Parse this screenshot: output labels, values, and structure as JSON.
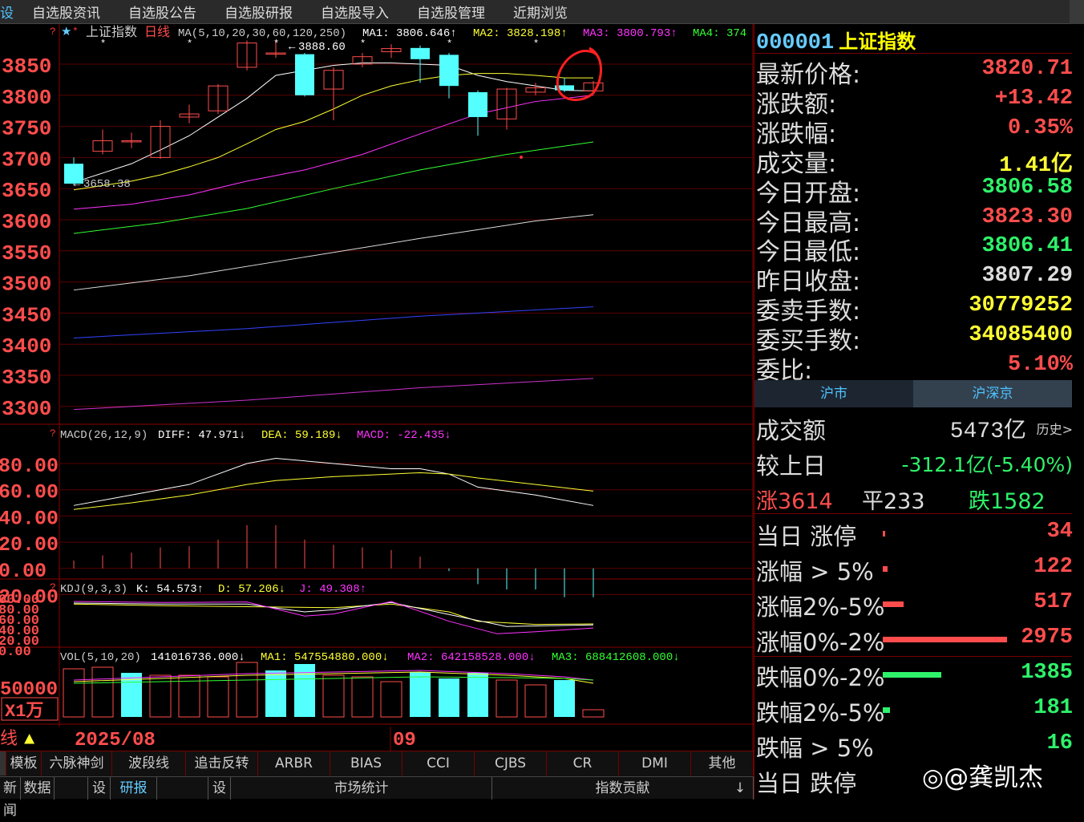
{
  "menu": [
    "设",
    "自选股资讯",
    "自选股公告",
    "自选股研报",
    "自选股导入",
    "自选股管理",
    "近期浏览"
  ],
  "chart": {
    "title": "上证指数",
    "period": "日线",
    "ma_params": "MA(5,10,20,30,60,120,250)",
    "ma1": "MA1: 3806.646↑",
    "ma2": "MA2: 3828.198↑",
    "ma3": "MA3: 3800.793↑",
    "ma4": "MA4: 374",
    "high_label": "3888.60",
    "low_label": "3658.38",
    "price_ticks": [
      "3850",
      "3800",
      "3750",
      "3700",
      "3650",
      "3600",
      "3550",
      "3500",
      "3450",
      "3400",
      "3350",
      "3300"
    ],
    "macd_title": "MACD(26,12,9)",
    "macd_diff": "DIFF: 47.971↓",
    "macd_dea": "DEA: 59.189↓",
    "macd_val": "MACD: -22.435↓",
    "macd_ticks": [
      "80.00",
      "60.00",
      "40.00",
      "20.00",
      "0.00",
      "20.00"
    ],
    "kdj_title": "KDJ(9,3,3)",
    "kdj_k": "K: 54.573↑",
    "kdj_d": "D: 57.206↓",
    "kdj_j": "J: 49.308↑",
    "kdj_ticks": [
      "00.00",
      "80.00",
      "60.00",
      "40.00",
      "20.00",
      "0.00"
    ],
    "vol_title": "VOL(5,10,20)",
    "vol_val": "141016736.000↓",
    "vol_ma1": "MA1: 547554880.000↓",
    "vol_ma2": "MA2: 642158528.000↓",
    "vol_ma3": "MA3: 688412608.000↓",
    "vol_tick": "50000",
    "vol_unit": "X1万",
    "line_label": "线",
    "date_left": "2025/08",
    "date_mid": "09"
  },
  "bottom_tabs": [
    "模板",
    "六脉神剑",
    "波段线",
    "追击反转",
    "ARBR",
    "BIAS",
    "CCI",
    "CJBS",
    "CR",
    "DMI",
    "其他"
  ],
  "bottom_tabs2": [
    "新闻",
    "数据",
    "设",
    "研报",
    "设",
    "市场统计",
    "指数贡献"
  ],
  "quote": {
    "code": "000001",
    "name": "上证指数",
    "rows": [
      {
        "label": "最新价格:",
        "value": "3820.71",
        "color": "#ff4d4d"
      },
      {
        "label": "涨跌额:",
        "value": "+13.42",
        "color": "#ff4d4d"
      },
      {
        "label": "涨跌幅:",
        "value": "0.35%",
        "color": "#ff4d4d"
      },
      {
        "label": "成交量:",
        "value": "1.41亿",
        "color": "#ffff33"
      },
      {
        "label": "今日开盘:",
        "value": "3806.58",
        "color": "#2ef26a"
      },
      {
        "label": "今日最高:",
        "value": "3823.30",
        "color": "#ff4d4d"
      },
      {
        "label": "今日最低:",
        "value": "3806.41",
        "color": "#2ef26a"
      },
      {
        "label": "昨日收盘:",
        "value": "3807.29",
        "color": "#dddddd"
      },
      {
        "label": "委卖手数:",
        "value": "30779252",
        "color": "#ffff33"
      },
      {
        "label": "委买手数:",
        "value": "34085400",
        "color": "#ffff33"
      },
      {
        "label": "委比:",
        "value": "5.10%",
        "color": "#ff4d4d"
      }
    ]
  },
  "market": {
    "tab1": "沪市",
    "tab2": "沪深京",
    "turnover_label": "成交额",
    "turnover_value": "5473亿",
    "history": "历史>",
    "compare_label": "较上日",
    "compare_value": "-312.1亿(-5.40%)",
    "up": "涨3614",
    "flat": "平233",
    "down": "跌1582",
    "stats": [
      {
        "label": "当日 涨停",
        "value": "34",
        "share": 0.01,
        "color": "#ff4d4d"
      },
      {
        "label": "涨幅 > 5%",
        "value": "122",
        "share": 0.04,
        "color": "#ff4d4d"
      },
      {
        "label": "涨幅2%-5%",
        "value": "517",
        "share": 0.17,
        "color": "#ff4d4d"
      },
      {
        "label": "涨幅0%-2%",
        "value": "2975",
        "share": 1.0,
        "color": "#ff4d4d"
      },
      {
        "label": "跌幅0%-2%",
        "value": "1385",
        "share": 0.47,
        "color": "#2ef26a"
      },
      {
        "label": "跌幅2%-5%",
        "value": "181",
        "share": 0.06,
        "color": "#2ef26a"
      },
      {
        "label": "跌幅 > 5%",
        "value": "16",
        "share": 0.0,
        "color": "#2ef26a"
      },
      {
        "label": "当日 跌停",
        "value": "",
        "share": 0.0,
        "color": "#2ef26a"
      }
    ]
  },
  "watermark": "@龚凯杰"
}
